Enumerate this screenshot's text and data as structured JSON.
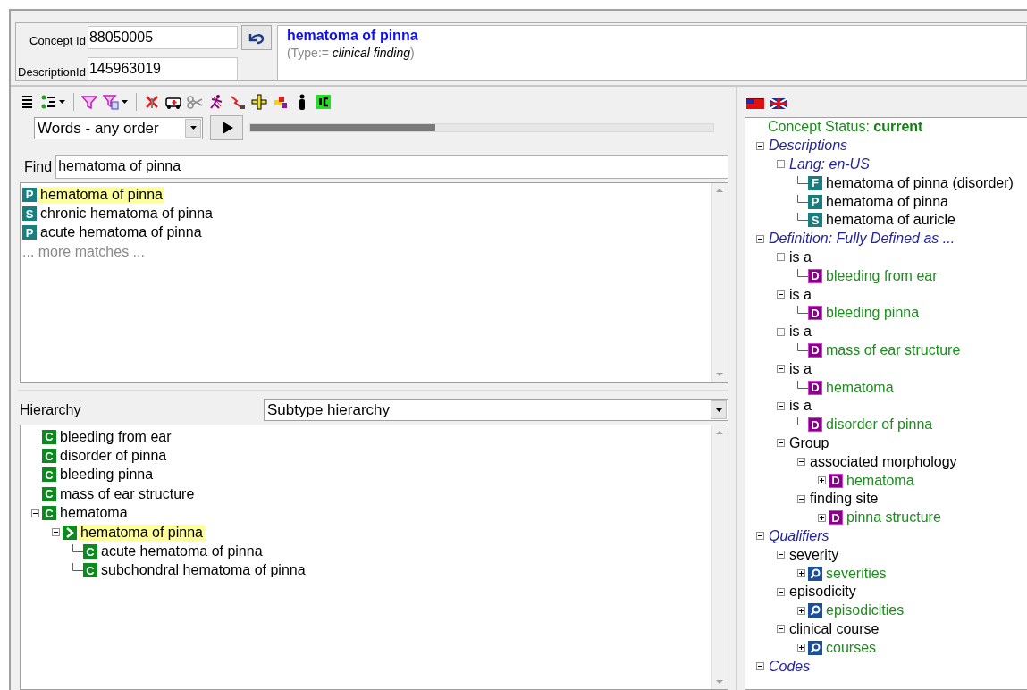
{
  "header": {
    "concept_id_label": "Concept Id",
    "concept_id": "88050005",
    "description_id_label": "DescriptionId",
    "description_id": "145963019",
    "title": "hematoma of pinna",
    "subtitle": "(Type:= *clinical finding*)"
  },
  "search": {
    "mode": "Words - any order",
    "progress": {
      "level": 0.4
    },
    "find_label": "Find",
    "find_value": "hematoma of pinna",
    "results": [
      {
        "badge": "P",
        "label": "hematoma of pinna",
        "selected": true
      },
      {
        "badge": "S",
        "label": "chronic hematoma of pinna",
        "selected": false
      },
      {
        "badge": "P",
        "label": "acute hematoma of pinna",
        "selected": false
      }
    ],
    "more": "... more matches ..."
  },
  "hierarchy": {
    "label": "Hierarchy",
    "view": "Subtype hierarchy",
    "items": [
      {
        "kind": "concept",
        "badge": "C",
        "label": "bleeding from ear",
        "selected": false
      },
      {
        "kind": "concept",
        "badge": "C",
        "label": "disorder of pinna",
        "selected": false
      },
      {
        "kind": "concept",
        "badge": "C",
        "label": "bleeding pinna",
        "selected": false
      },
      {
        "kind": "concept",
        "badge": "C",
        "label": "mass of ear structure",
        "selected": false
      },
      {
        "kind": "concept",
        "badge": "C",
        "label": "hematoma",
        "selected": false,
        "expanded": true,
        "children": [
          {
            "kind": "current",
            "label": "hematoma of pinna",
            "selected": true,
            "expanded": true,
            "children": [
              {
                "kind": "concept",
                "badge": "C",
                "label": "acute hematoma of pinna",
                "selected": false
              },
              {
                "kind": "concept",
                "badge": "C",
                "label": "subchondral hematoma of pinna",
                "selected": false
              }
            ]
          }
        ]
      }
    ]
  },
  "details": {
    "status_label": "Concept Status:",
    "status_value": "current",
    "sections": [
      {
        "kind": "section",
        "label": "Descriptions",
        "expanded": true,
        "children": [
          {
            "kind": "section",
            "label": "Lang: en-US",
            "expanded": true,
            "children": [
              {
                "kind": "description",
                "badge": "F",
                "label": "hematoma of pinna (disorder)"
              },
              {
                "kind": "description",
                "badge": "P",
                "label": "hematoma of pinna"
              },
              {
                "kind": "description",
                "badge": "S",
                "label": "hematoma of auricle"
              }
            ]
          }
        ]
      },
      {
        "kind": "section",
        "label": "Definition: Fully Defined as ...",
        "expanded": true,
        "children": [
          {
            "kind": "group",
            "label": "is a",
            "expanded": true,
            "children": [
              {
                "kind": "definition",
                "badge": "D",
                "label": "bleeding from ear"
              }
            ]
          },
          {
            "kind": "group",
            "label": "is a",
            "expanded": true,
            "children": [
              {
                "kind": "definition",
                "badge": "D",
                "label": "bleeding pinna"
              }
            ]
          },
          {
            "kind": "group",
            "label": "is a",
            "expanded": true,
            "children": [
              {
                "kind": "definition",
                "badge": "D",
                "label": "mass of ear structure"
              }
            ]
          },
          {
            "kind": "group",
            "label": "is a",
            "expanded": true,
            "children": [
              {
                "kind": "definition",
                "badge": "D",
                "label": "hematoma"
              }
            ]
          },
          {
            "kind": "group",
            "label": "is a",
            "expanded": true,
            "children": [
              {
                "kind": "definition",
                "badge": "D",
                "label": "disorder of pinna"
              }
            ]
          },
          {
            "kind": "group",
            "label": "Group",
            "expanded": true,
            "children": [
              {
                "kind": "group",
                "label": "associated morphology",
                "expanded": true,
                "children": [
                  {
                    "kind": "definition",
                    "badge": "D",
                    "label": "hematoma",
                    "expanded": false
                  }
                ]
              },
              {
                "kind": "group",
                "label": "finding site",
                "expanded": true,
                "children": [
                  {
                    "kind": "definition",
                    "badge": "D",
                    "label": "pinna structure",
                    "expanded": false
                  }
                ]
              }
            ]
          }
        ]
      },
      {
        "kind": "section",
        "label": "Qualifiers",
        "expanded": true,
        "children": [
          {
            "kind": "group",
            "label": "severity",
            "expanded": true,
            "children": [
              {
                "kind": "qualifier",
                "label": "severities",
                "expanded": false
              }
            ]
          },
          {
            "kind": "group",
            "label": "episodicity",
            "expanded": true,
            "children": [
              {
                "kind": "qualifier",
                "label": "episodicities",
                "expanded": false
              }
            ]
          },
          {
            "kind": "group",
            "label": "clinical course",
            "expanded": true,
            "children": [
              {
                "kind": "qualifier",
                "label": "courses",
                "expanded": false
              }
            ]
          }
        ]
      },
      {
        "kind": "section",
        "label": "Codes",
        "expanded": true
      }
    ]
  }
}
